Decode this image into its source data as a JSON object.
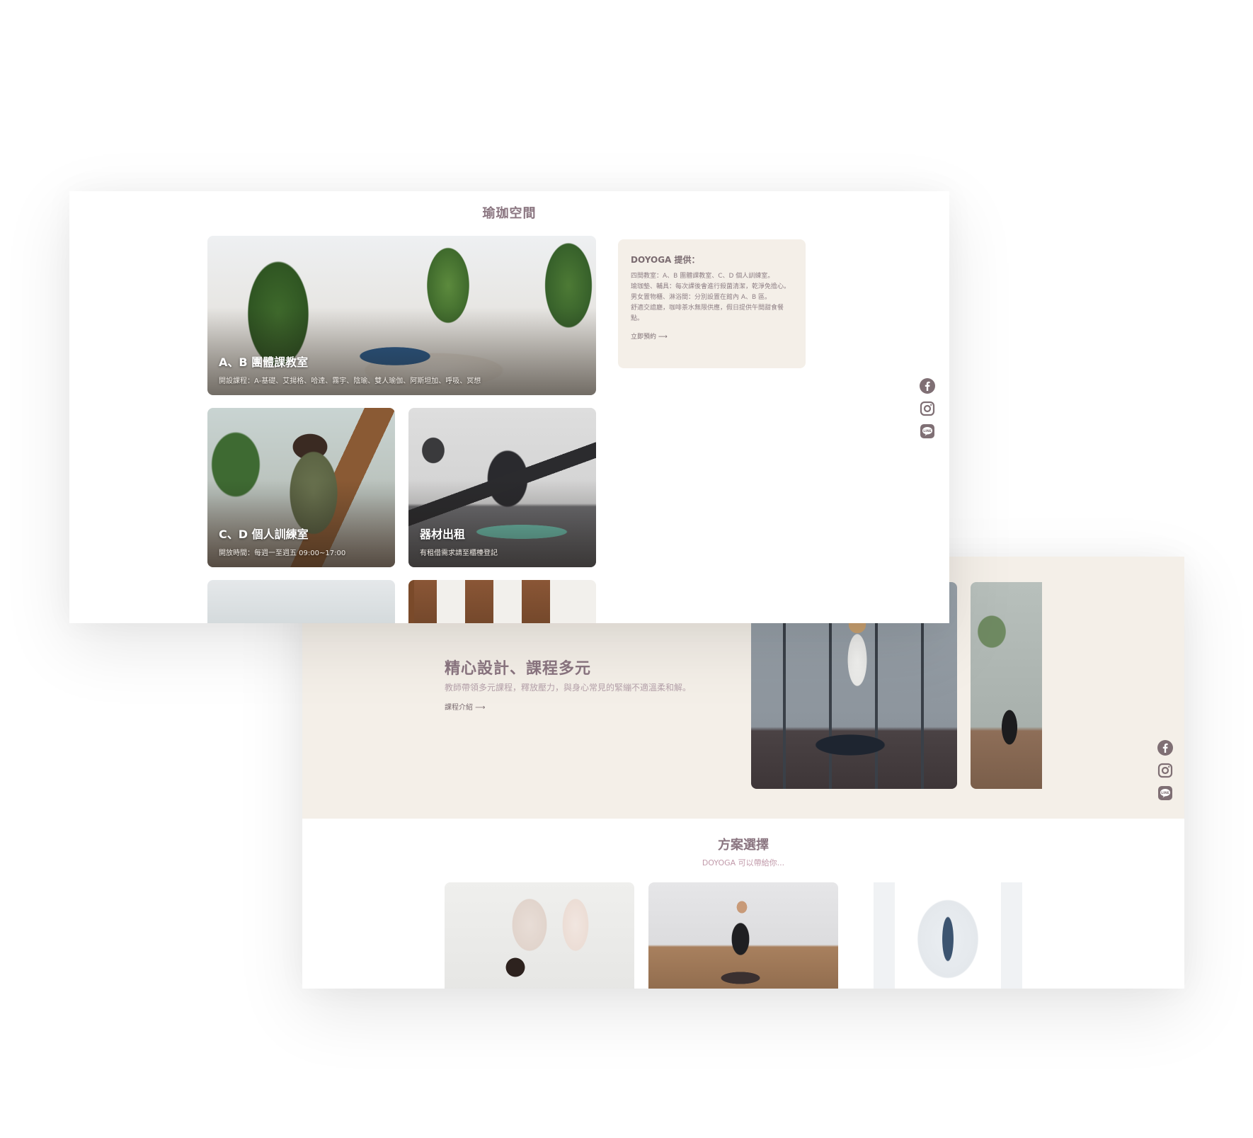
{
  "space_section": {
    "title": "瑜珈空間",
    "cards": [
      {
        "title": "A、B 團體課教室",
        "subtitle": "開設課程：A-基礎、艾揚格、哈達、霧宇、陰瑜、雙人瑜伽、阿斯坦加、呼吸、冥想"
      },
      {
        "title": "C、D 個人訓練室",
        "subtitle": "開放時間：每週一至週五 09:00~17:00"
      },
      {
        "title": "器材出租",
        "subtitle": "有租借需求請至櫃檯登記"
      }
    ],
    "info": {
      "title": "DOYOGA 提供：",
      "lines": [
        "四間教室：A、B 團體課教室、C、D 個人訓練室。",
        "瑜珈墊、輔具：每次課後會進行殺菌清潔，乾淨免擔心。",
        "男女置物櫃、淋浴間：分別設置在館內 A、B 區。",
        "舒適交誼廳，咖啡茶水無限供應，假日提供午間甜食餐點。"
      ],
      "link": "立即預約 ⟶"
    }
  },
  "course_section": {
    "title": "精心設計、課程多元",
    "description": "教師帶領多元課程，釋放壓力，與身心常見的緊繃不適溫柔和解。",
    "link": "課程介紹 ⟶"
  },
  "plan_section": {
    "title": "方案選擇",
    "subtitle": "DOYOGA 可以帶給你..."
  },
  "social_icons": [
    "facebook-icon",
    "instagram-icon",
    "line-icon"
  ],
  "colors": {
    "accent": "#8a7580",
    "beige": "#f4efe8",
    "subtitle_pink": "#c19aaa"
  }
}
